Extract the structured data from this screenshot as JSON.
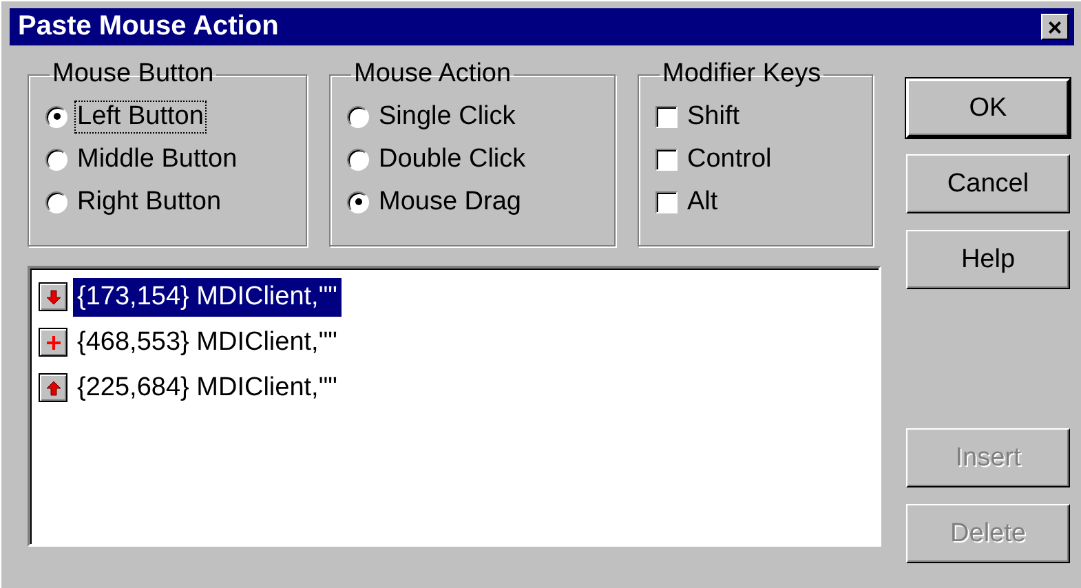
{
  "window": {
    "title": "Paste Mouse Action",
    "close": "×"
  },
  "groups": [
    {
      "title": "Mouse Button",
      "kind": "radio",
      "options": [
        {
          "label": "Left Button",
          "selected": true,
          "focused": true
        },
        {
          "label": "Middle Button",
          "selected": false,
          "focused": false
        },
        {
          "label": "Right Button",
          "selected": false,
          "focused": false
        }
      ]
    },
    {
      "title": "Mouse Action",
      "kind": "radio",
      "options": [
        {
          "label": "Single Click",
          "selected": false,
          "focused": false
        },
        {
          "label": "Double Click",
          "selected": false,
          "focused": false
        },
        {
          "label": "Mouse Drag",
          "selected": true,
          "focused": false
        }
      ]
    },
    {
      "title": "Modifier Keys",
      "kind": "check",
      "options": [
        {
          "label": "Shift",
          "checked": false
        },
        {
          "label": "Control",
          "checked": false
        },
        {
          "label": "Alt",
          "checked": false
        }
      ]
    }
  ],
  "actions": [
    {
      "kind": "down",
      "text": "{173,154} MDIClient,\"\"",
      "selected": true
    },
    {
      "kind": "plus",
      "text": "{468,553} MDIClient,\"\"",
      "selected": false
    },
    {
      "kind": "up",
      "text": "{225,684} MDIClient,\"\"",
      "selected": false
    }
  ],
  "top_buttons": [
    {
      "label": "OK",
      "default": true,
      "disabled": false
    },
    {
      "label": "Cancel",
      "default": false,
      "disabled": false
    },
    {
      "label": "Help",
      "default": false,
      "disabled": false
    }
  ],
  "bottom_buttons": [
    {
      "label": "Insert",
      "default": false,
      "disabled": true
    },
    {
      "label": "Delete",
      "default": false,
      "disabled": true
    }
  ]
}
